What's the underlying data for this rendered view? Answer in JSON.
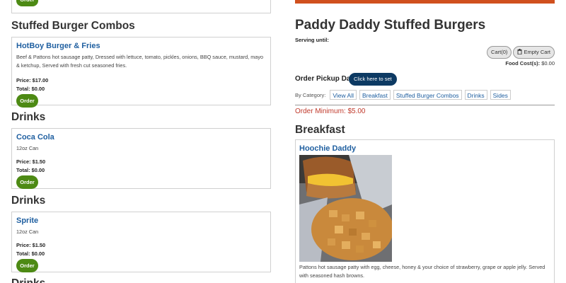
{
  "left": {
    "top_stub": {
      "order_label": "Order"
    },
    "sections": [
      {
        "heading": "Stuffed Burger Combos",
        "item": {
          "name": "HotBoy Burger & Fries",
          "description": "Beef & Pattons hot sausage patty, Dressed with lettuce, tomato, pickles, onions, BBQ sauce, mustard, mayo & ketchup, Served with fresh cut seasoned fries.",
          "price": "Price: $17.00",
          "total": "Total: $0.00",
          "order_label": "Order"
        }
      },
      {
        "heading": "Drinks",
        "item": {
          "name": "Coca Cola",
          "description": "12oz Can",
          "price": "Price: $1.50",
          "total": "Total: $0.00",
          "order_label": "Order"
        }
      },
      {
        "heading": "Drinks",
        "item": {
          "name": "Sprite",
          "description": "12oz Can",
          "price": "Price: $1.50",
          "total": "Total: $0.00",
          "order_label": "Order"
        }
      }
    ],
    "bottom_heading": "Drinks"
  },
  "right": {
    "title": "Paddy Daddy Stuffed Burgers",
    "serving": "Serving until:",
    "cart_label": "Cart(0)",
    "empty_cart_label": "Empty Cart",
    "food_cost_label": "Food Cost(s):",
    "food_cost_value": "$0.00",
    "pickup_label": "Order Pickup Day:",
    "pickup_button": "Click here to set",
    "category_label": "By Category:",
    "categories": [
      "View All",
      "Breakfast",
      "Stuffed Burger Combos",
      "Drinks",
      "Sides"
    ],
    "order_minimum": "Order Minimum: $5.00",
    "breakfast_heading": "Breakfast",
    "breakfast_item": {
      "name": "Hoochie Daddy",
      "description": "Pattons hot sausage patty with egg, cheese, honey & your choice of strawberry, grape or apple jelly. Served with seasoned hash browns."
    }
  },
  "colors": {
    "accent_green": "#4d8a14",
    "link_blue": "#1f5fa0",
    "pickup_navy": "#0d3a63",
    "alert_red": "#c0392b",
    "top_bar_orange": "#d0501e"
  },
  "icons": {
    "empty_cart": "trash-icon"
  }
}
